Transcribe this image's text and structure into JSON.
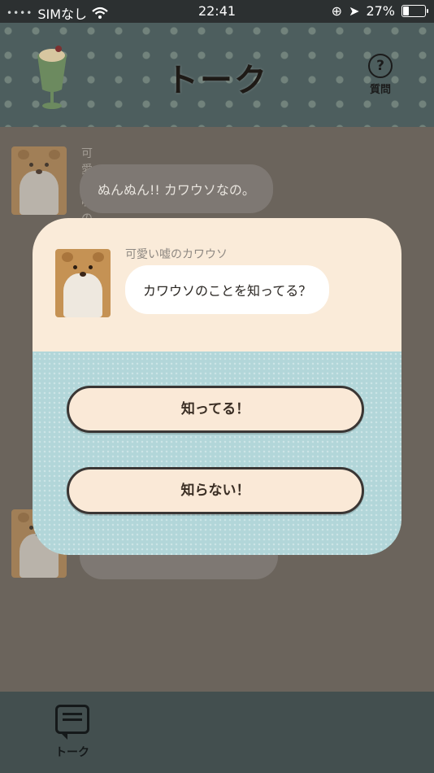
{
  "status_bar": {
    "carrier": "SIMなし",
    "time": "22:41",
    "battery_percent": "27%"
  },
  "header": {
    "title": "トーク",
    "help_label": "質問",
    "help_icon_text": "?"
  },
  "chat": {
    "messages": [
      {
        "sender": "可愛い嘘のカワウソ",
        "text": "ぬんぬん!! カワウソなの。"
      },
      {
        "sender": "",
        "text": ""
      }
    ]
  },
  "modal": {
    "sender": "可愛い嘘のカワウソ",
    "question": "カワウソのことを知ってる？",
    "choices": [
      {
        "label": "知ってる！"
      },
      {
        "label": "知らない！"
      }
    ]
  },
  "tabbar": {
    "items": [
      {
        "label": "トーク"
      }
    ]
  },
  "colors": {
    "overlay_dim": "#6b645c",
    "modal_top": "#faebd9",
    "modal_bottom": "#b2d6d9",
    "button_fill": "#fae9d7",
    "button_border": "#3a3634"
  }
}
